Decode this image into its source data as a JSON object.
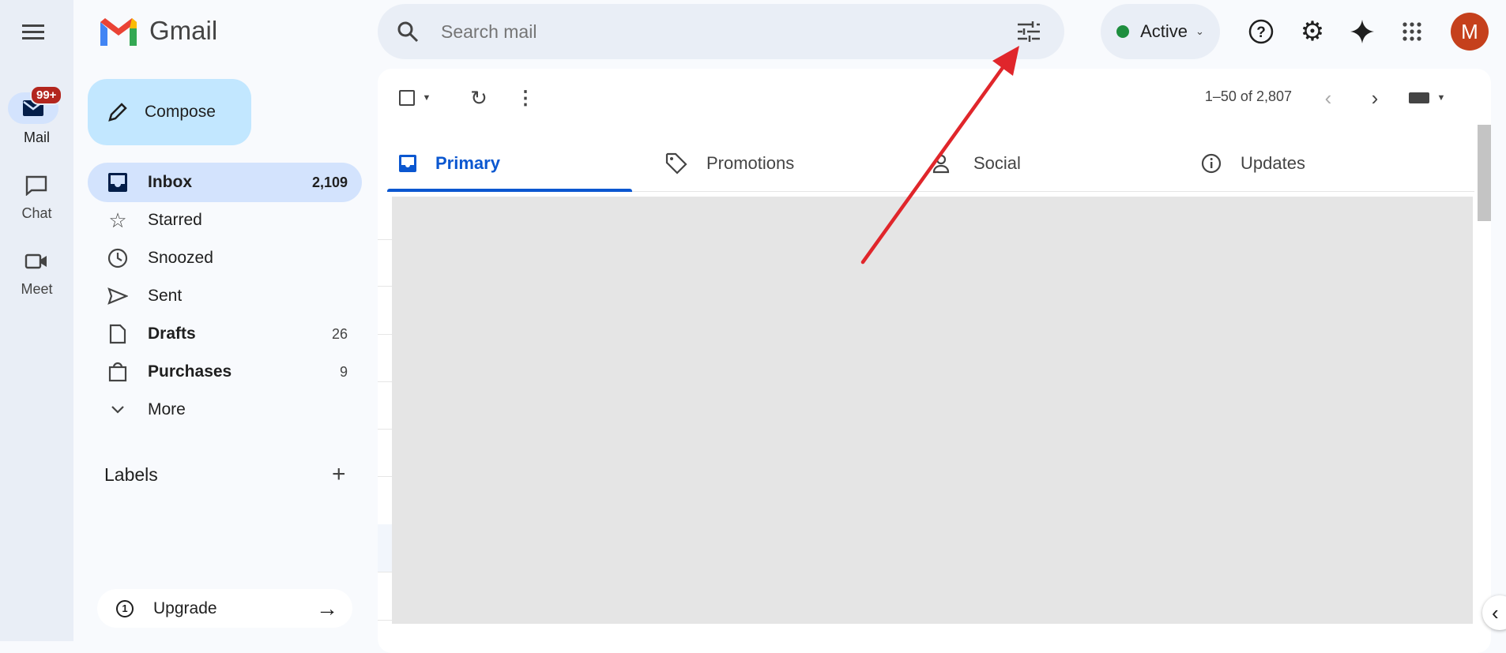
{
  "app": {
    "name": "Gmail"
  },
  "rail": {
    "items": [
      {
        "label": "Mail",
        "badge": "99+"
      },
      {
        "label": "Chat"
      },
      {
        "label": "Meet"
      }
    ]
  },
  "compose": {
    "label": "Compose"
  },
  "nav": {
    "items": [
      {
        "label": "Inbox",
        "count": "2,109",
        "icon": "inbox-icon"
      },
      {
        "label": "Starred",
        "count": "",
        "icon": "star-icon"
      },
      {
        "label": "Snoozed",
        "count": "",
        "icon": "clock-icon"
      },
      {
        "label": "Sent",
        "count": "",
        "icon": "send-icon"
      },
      {
        "label": "Drafts",
        "count": "26",
        "icon": "file-icon"
      },
      {
        "label": "Purchases",
        "count": "9",
        "icon": "bag-icon"
      },
      {
        "label": "More",
        "count": "",
        "icon": "chevron-down-icon"
      }
    ]
  },
  "labels": {
    "heading": "Labels"
  },
  "upgrade": {
    "label": "Upgrade"
  },
  "search": {
    "placeholder": "Search mail"
  },
  "status": {
    "label": "Active",
    "color": "#1e8e3e"
  },
  "avatar": {
    "initial": "M",
    "color": "#c5401c"
  },
  "toolbar": {
    "pager": "1–50 of 2,807"
  },
  "tabs": [
    {
      "label": "Primary"
    },
    {
      "label": "Promotions"
    },
    {
      "label": "Social"
    },
    {
      "label": "Updates"
    }
  ],
  "colors": {
    "accent": "#0b57d0",
    "annotation_arrow": "#e0262b"
  }
}
